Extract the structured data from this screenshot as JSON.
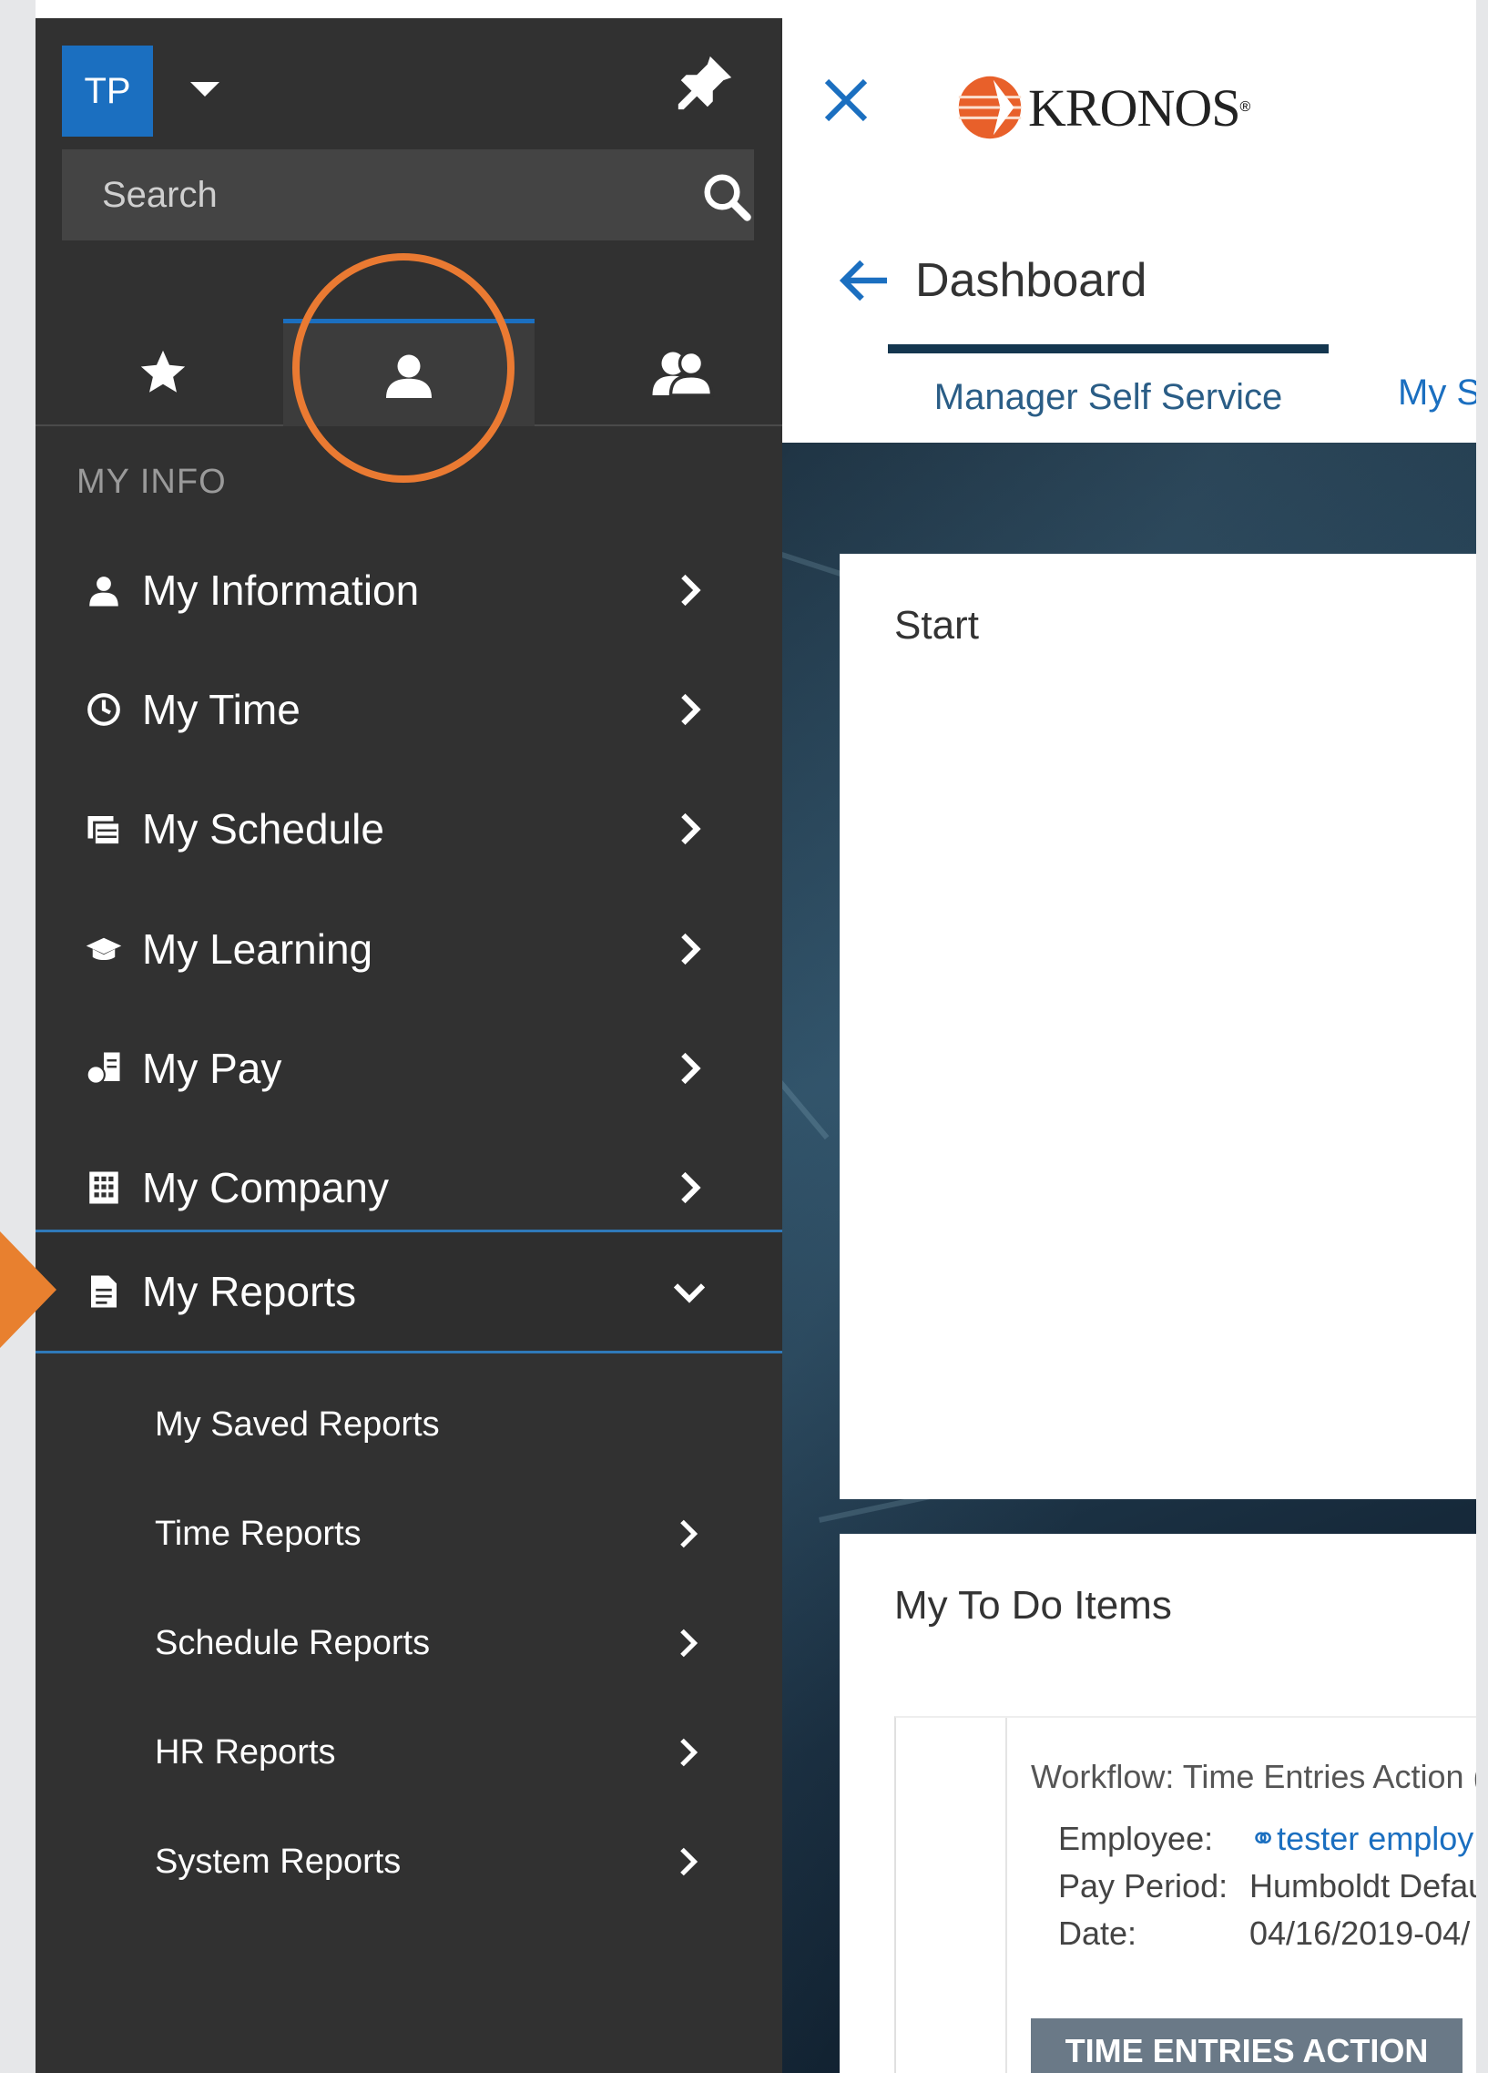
{
  "user": {
    "initials": "TP"
  },
  "search": {
    "placeholder": "Search"
  },
  "sidebar": {
    "section_label": "MY INFO",
    "items": [
      {
        "label": "My Information"
      },
      {
        "label": "My Time"
      },
      {
        "label": "My Schedule"
      },
      {
        "label": "My Learning"
      },
      {
        "label": "My Pay"
      },
      {
        "label": "My Company"
      },
      {
        "label": "My Reports"
      }
    ],
    "reports_subitems": [
      {
        "label": "My Saved Reports"
      },
      {
        "label": "Time Reports"
      },
      {
        "label": "Schedule Reports"
      },
      {
        "label": "HR Reports"
      },
      {
        "label": "System Reports"
      }
    ]
  },
  "header": {
    "brand": "KRONOS",
    "page_title": "Dashboard"
  },
  "dashboard": {
    "tabs": [
      {
        "label": "Manager Self Service"
      },
      {
        "label": "My S"
      }
    ],
    "start_card": {
      "title": "Start"
    },
    "todo_card": {
      "title": "My To Do Items",
      "workflow": {
        "title": "Workflow: Time Entries Action (",
        "employee_label": "Employee:",
        "employee_value": "tester employ",
        "pay_period_label": "Pay Period:",
        "pay_period_value": "Humboldt Defau",
        "date_label": "Date:",
        "date_value": "04/16/2019-04/",
        "action_label": "TIME ENTRIES ACTION"
      }
    }
  },
  "colors": {
    "sidebar_bg": "#313131",
    "accent_blue": "#1b6fc0",
    "highlight_orange": "#ea7a32",
    "tab_underline": "#14364f"
  }
}
